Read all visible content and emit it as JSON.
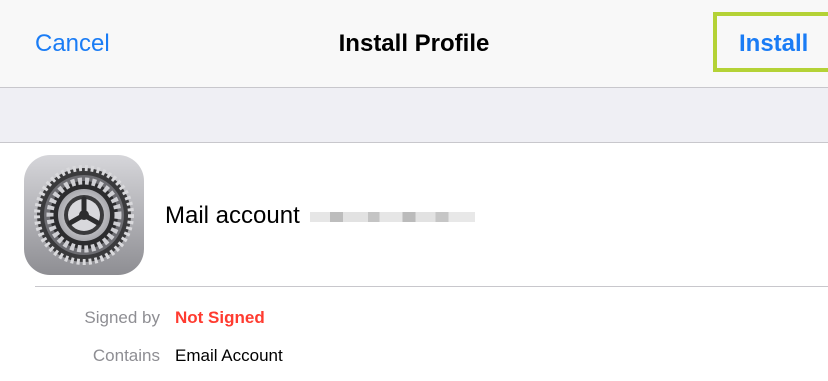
{
  "navbar": {
    "cancel_label": "Cancel",
    "title": "Install Profile",
    "install_label": "Install"
  },
  "profile": {
    "icon": "settings-gear-icon",
    "name": "Mail account"
  },
  "details": {
    "signed_by_label": "Signed by",
    "signed_by_value": "Not Signed",
    "contains_label": "Contains",
    "contains_value": "Email Account"
  },
  "colors": {
    "accent": "#1a7cf5",
    "warning": "#ff3b30",
    "highlight": "#b4d236",
    "secondary_text": "#8e8e93"
  }
}
